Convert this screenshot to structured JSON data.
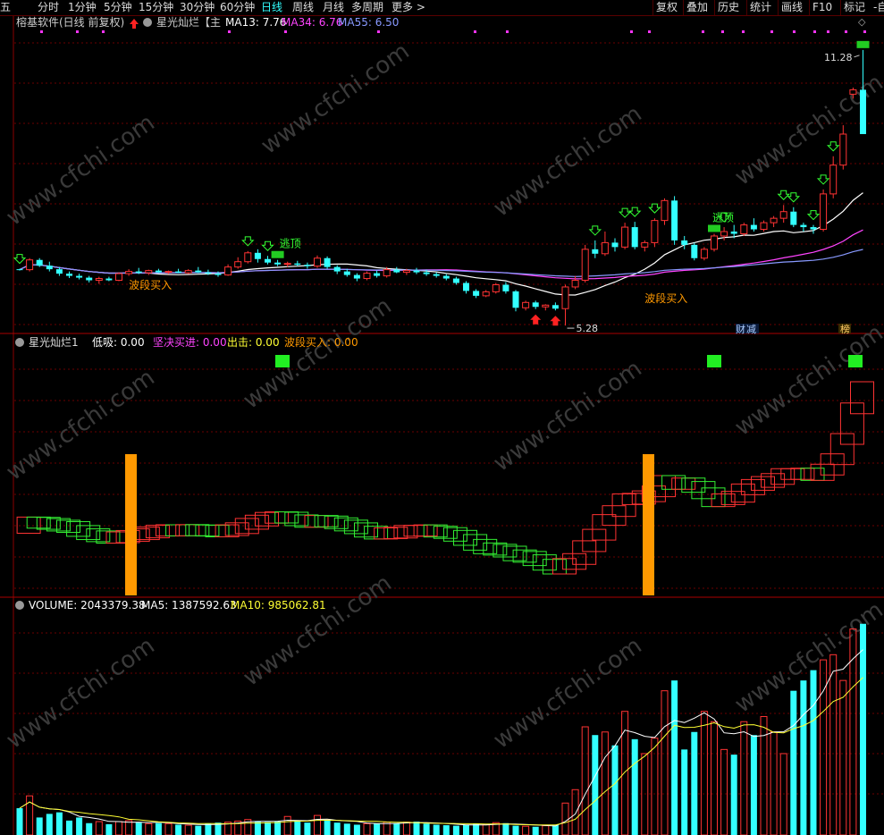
{
  "toolbar": {
    "left_items": [
      {
        "label": "分时",
        "active": false
      },
      {
        "label": "1分钟",
        "active": false
      },
      {
        "label": "5分钟",
        "active": false
      },
      {
        "label": "15分钟",
        "active": false
      },
      {
        "label": "30分钟",
        "active": false
      },
      {
        "label": "60分钟",
        "active": false
      },
      {
        "label": "日线",
        "active": true
      },
      {
        "label": "周线",
        "active": false
      },
      {
        "label": "月线",
        "active": false
      },
      {
        "label": "多周期",
        "active": false
      },
      {
        "label": "更多 >",
        "active": false
      }
    ],
    "right_items": [
      "复权",
      "叠加",
      "历史",
      "统计",
      "画线",
      "F10",
      "标记"
    ],
    "edge_left": "五",
    "edge_right": "-自"
  },
  "main_panel": {
    "stock_name": "榕基软件",
    "period_label": "(日线 前复权)",
    "indicator_name": "星光灿烂【主",
    "ma": [
      {
        "label": "MA13:",
        "value": "7.76",
        "color": "#ffffff"
      },
      {
        "label": "MA34:",
        "value": "6.76",
        "color": "#ff44ff"
      },
      {
        "label": "MA55:",
        "value": "6.50",
        "color": "#8899ff"
      }
    ],
    "high_label": "11.28",
    "low_label": "5.28",
    "signals": {
      "top": "逃顶",
      "buy": "波段买入"
    },
    "badges": {
      "finance": "财",
      "cut": "减",
      "rank": "榜"
    }
  },
  "indicator_panel": {
    "name": "星光灿烂1",
    "items": [
      {
        "label": "低吸:",
        "value": "0.00",
        "color": "#ffffff"
      },
      {
        "label": "坚决买进:",
        "value": "0.00",
        "color": "#ff44ff"
      },
      {
        "label": "出击:",
        "value": "0.00",
        "color": "#ffff33"
      },
      {
        "label": "波段买入:",
        "value": "0.00",
        "color": "#ff9900"
      }
    ]
  },
  "volume_panel": {
    "items": [
      {
        "label": "VOLUME:",
        "value": "2043379.38",
        "color": "#ffffff"
      },
      {
        "label": "MA5:",
        "value": "1387592.63",
        "color": "#ffffff"
      },
      {
        "label": "MA10:",
        "value": "985062.81",
        "color": "#ffff33"
      }
    ]
  },
  "watermark": "www.cfchi.com",
  "chart_data": {
    "type": "candlestick",
    "candles": [
      [
        6.55,
        6.56,
        6.52,
        6.54
      ],
      [
        6.54,
        6.8,
        6.5,
        6.76
      ],
      [
        6.76,
        6.8,
        6.6,
        6.63
      ],
      [
        6.63,
        6.72,
        6.5,
        6.55
      ],
      [
        6.55,
        6.6,
        6.4,
        6.45
      ],
      [
        6.45,
        6.5,
        6.35,
        6.4
      ],
      [
        6.4,
        6.45,
        6.32,
        6.36
      ],
      [
        6.36,
        6.4,
        6.25,
        6.3
      ],
      [
        6.3,
        6.38,
        6.22,
        6.34
      ],
      [
        6.34,
        6.38,
        6.28,
        6.3
      ],
      [
        6.3,
        6.48,
        6.28,
        6.45
      ],
      [
        6.45,
        6.55,
        6.4,
        6.5
      ],
      [
        6.5,
        6.58,
        6.44,
        6.47
      ],
      [
        6.47,
        6.54,
        6.42,
        6.52
      ],
      [
        6.52,
        6.56,
        6.46,
        6.48
      ],
      [
        6.48,
        6.52,
        6.44,
        6.5
      ],
      [
        6.5,
        6.56,
        6.46,
        6.47
      ],
      [
        6.47,
        6.55,
        6.44,
        6.52
      ],
      [
        6.52,
        6.6,
        6.46,
        6.48
      ],
      [
        6.48,
        6.54,
        6.42,
        6.45
      ],
      [
        6.45,
        6.5,
        6.38,
        6.42
      ],
      [
        6.42,
        6.66,
        6.4,
        6.6
      ],
      [
        6.6,
        6.82,
        6.56,
        6.72
      ],
      [
        6.72,
        6.96,
        6.68,
        6.92
      ],
      [
        6.92,
        7.0,
        6.7,
        6.78
      ],
      [
        6.78,
        6.85,
        6.66,
        6.7
      ],
      [
        6.7,
        6.76,
        6.62,
        6.66
      ],
      [
        6.66,
        6.72,
        6.6,
        6.68
      ],
      [
        6.68,
        6.74,
        6.62,
        6.65
      ],
      [
        6.65,
        6.7,
        6.56,
        6.62
      ],
      [
        6.62,
        6.86,
        6.58,
        6.8
      ],
      [
        6.8,
        6.84,
        6.56,
        6.6
      ],
      [
        6.6,
        6.64,
        6.44,
        6.5
      ],
      [
        6.5,
        6.56,
        6.38,
        6.42
      ],
      [
        6.42,
        6.46,
        6.28,
        6.34
      ],
      [
        6.34,
        6.5,
        6.3,
        6.46
      ],
      [
        6.46,
        6.52,
        6.36,
        6.4
      ],
      [
        6.4,
        6.6,
        6.36,
        6.54
      ],
      [
        6.54,
        6.6,
        6.46,
        6.48
      ],
      [
        6.48,
        6.56,
        6.42,
        6.52
      ],
      [
        6.52,
        6.58,
        6.44,
        6.48
      ],
      [
        6.48,
        6.54,
        6.4,
        6.44
      ],
      [
        6.44,
        6.48,
        6.36,
        6.4
      ],
      [
        6.4,
        6.44,
        6.3,
        6.34
      ],
      [
        6.34,
        6.38,
        6.2,
        6.24
      ],
      [
        6.24,
        6.28,
        6.0,
        6.06
      ],
      [
        6.06,
        6.1,
        5.9,
        5.95
      ],
      [
        5.95,
        6.08,
        5.92,
        6.04
      ],
      [
        6.04,
        6.24,
        6.0,
        6.2
      ],
      [
        6.2,
        6.26,
        6.0,
        6.05
      ],
      [
        6.05,
        6.08,
        5.6,
        5.68
      ],
      [
        5.68,
        5.84,
        5.62,
        5.8
      ],
      [
        5.8,
        5.84,
        5.65,
        5.7
      ],
      [
        5.7,
        5.76,
        5.62,
        5.74
      ],
      [
        5.74,
        5.8,
        5.62,
        5.66
      ],
      [
        5.66,
        6.2,
        5.28,
        6.15
      ],
      [
        6.15,
        6.4,
        6.1,
        6.3
      ],
      [
        6.3,
        7.1,
        6.25,
        7.0
      ],
      [
        7.0,
        7.2,
        6.8,
        6.9
      ],
      [
        6.9,
        7.4,
        6.85,
        7.15
      ],
      [
        7.15,
        7.25,
        6.95,
        7.05
      ],
      [
        7.05,
        7.6,
        7.0,
        7.5
      ],
      [
        7.5,
        7.62,
        7.0,
        7.05
      ],
      [
        7.05,
        7.2,
        6.95,
        7.15
      ],
      [
        7.15,
        7.7,
        7.05,
        7.65
      ],
      [
        7.65,
        8.15,
        7.55,
        8.1
      ],
      [
        8.1,
        8.2,
        7.1,
        7.2
      ],
      [
        7.2,
        7.3,
        7.0,
        7.1
      ],
      [
        7.1,
        7.15,
        6.75,
        6.8
      ],
      [
        6.8,
        7.05,
        6.75,
        7.0
      ],
      [
        7.0,
        7.35,
        6.95,
        7.3
      ],
      [
        7.3,
        7.5,
        7.2,
        7.4
      ],
      [
        7.4,
        7.55,
        7.25,
        7.35
      ],
      [
        7.35,
        7.6,
        7.3,
        7.55
      ],
      [
        7.55,
        7.7,
        7.4,
        7.45
      ],
      [
        7.45,
        7.65,
        7.4,
        7.6
      ],
      [
        7.6,
        7.75,
        7.5,
        7.7
      ],
      [
        7.7,
        8.0,
        7.6,
        7.85
      ],
      [
        7.85,
        7.95,
        7.5,
        7.55
      ],
      [
        7.55,
        7.6,
        7.4,
        7.5
      ],
      [
        7.5,
        7.55,
        7.35,
        7.45
      ],
      [
        7.45,
        8.35,
        7.4,
        8.25
      ],
      [
        8.25,
        9.1,
        8.15,
        8.9
      ],
      [
        8.9,
        9.8,
        8.8,
        9.6
      ],
      [
        10.5,
        10.65,
        10.4,
        10.6
      ],
      [
        10.6,
        11.5,
        9.6,
        9.6
      ]
    ],
    "volume": [
      260,
      380,
      170,
      205,
      220,
      140,
      170,
      115,
      130,
      105,
      130,
      140,
      120,
      110,
      115,
      110,
      100,
      95,
      90,
      110,
      120,
      125,
      135,
      150,
      130,
      125,
      130,
      180,
      140,
      120,
      190,
      140,
      120,
      110,
      100,
      110,
      110,
      125,
      115,
      125,
      130,
      110,
      100,
      95,
      90,
      95,
      110,
      100,
      120,
      115,
      90,
      85,
      80,
      90,
      95,
      310,
      440,
      1050,
      970,
      1000,
      870,
      1200,
      930,
      790,
      940,
      1400,
      1500,
      830,
      1000,
      1200,
      1100,
      830,
      780,
      1100,
      970,
      1150,
      1000,
      790,
      1400,
      1500,
      1600,
      1700,
      1750,
      1500,
      2000,
      2050
    ],
    "price_range": [
      5.1,
      11.9
    ],
    "volume_max": 2100
  }
}
